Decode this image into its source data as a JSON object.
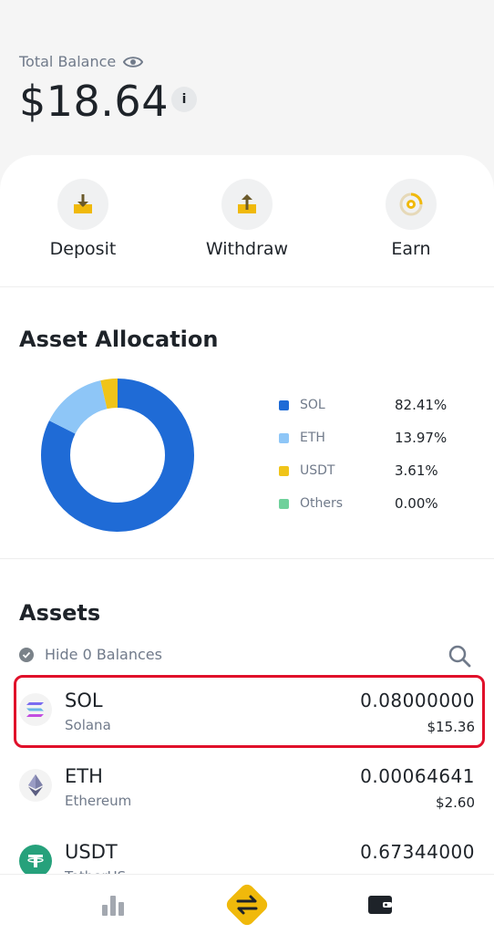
{
  "header": {
    "total_balance_label": "Total Balance",
    "total_balance_value": "$18.64",
    "info_glyph": "i"
  },
  "actions": [
    {
      "label": "Deposit",
      "icon": "deposit-icon"
    },
    {
      "label": "Withdraw",
      "icon": "withdraw-icon"
    },
    {
      "label": "Earn",
      "icon": "earn-icon"
    }
  ],
  "allocation": {
    "title": "Asset Allocation",
    "items": [
      {
        "name": "SOL",
        "percent": "82.41%",
        "value": 82.41,
        "color": "#1f6bd6"
      },
      {
        "name": "ETH",
        "percent": "13.97%",
        "value": 13.97,
        "color": "#8ec6f7"
      },
      {
        "name": "USDT",
        "percent": "3.61%",
        "value": 3.61,
        "color": "#f0c419"
      },
      {
        "name": "Others",
        "percent": "0.00%",
        "value": 0.0,
        "color": "#6fd19b"
      }
    ]
  },
  "chart_data": {
    "type": "pie",
    "categories": [
      "SOL",
      "ETH",
      "USDT",
      "Others"
    ],
    "values": [
      82.41,
      13.97,
      3.61,
      0.0
    ],
    "title": "Asset Allocation",
    "colors": [
      "#1f6bd6",
      "#8ec6f7",
      "#f0c419",
      "#6fd19b"
    ]
  },
  "assets": {
    "title": "Assets",
    "hide_label": "Hide 0 Balances",
    "rows": [
      {
        "symbol": "SOL",
        "name": "Solana",
        "amount": "0.08000000",
        "usd": "$15.36",
        "icon": "solana-icon"
      },
      {
        "symbol": "ETH",
        "name": "Ethereum",
        "amount": "0.00064641",
        "usd": "$2.60",
        "icon": "ethereum-icon"
      },
      {
        "symbol": "USDT",
        "name": "TetherUS",
        "amount": "0.67344000",
        "usd": "",
        "icon": "tether-icon"
      }
    ]
  },
  "nav": {
    "items": [
      "markets-icon",
      "trade-icon",
      "wallet-icon"
    ],
    "accent": "#f0b90b"
  }
}
